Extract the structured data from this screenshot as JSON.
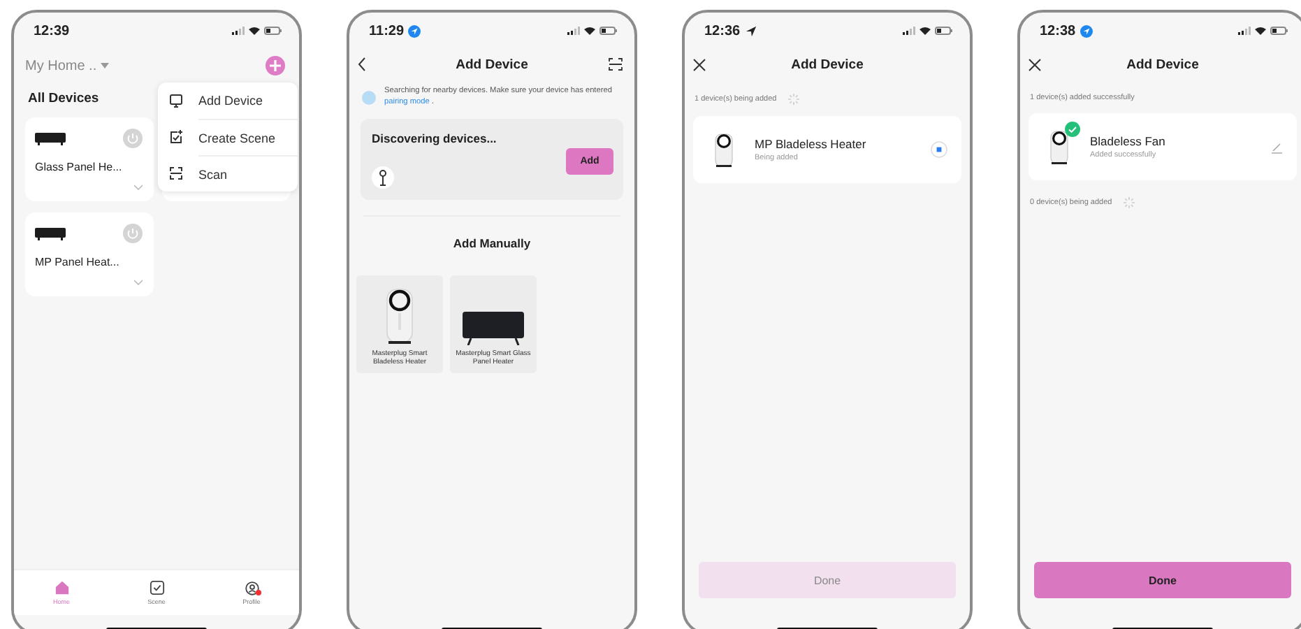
{
  "phones": [
    {
      "kind": "home",
      "time": "12:39",
      "home_name": "My Home ..",
      "section": "All Devices",
      "devices": [
        {
          "name": "Glass Panel He..."
        },
        {
          "name": "MP Panel Heat..."
        }
      ],
      "menu": [
        {
          "label": "Add Device",
          "kind": "device"
        },
        {
          "label": "Create Scene",
          "kind": "scene"
        },
        {
          "label": "Scan",
          "kind": "scan"
        }
      ],
      "tabs": [
        {
          "label": "Home",
          "kind": "home",
          "selected": true
        },
        {
          "label": "Scene",
          "kind": "scene",
          "selected": false
        },
        {
          "label": "Profile",
          "kind": "profile",
          "selected": false,
          "badge": true
        }
      ]
    },
    {
      "kind": "discover",
      "time": "11:29",
      "location": {
        "kind": "dot"
      },
      "title": "Add Device",
      "notice": "Searching for nearby devices. Make sure your device has entered ",
      "notice_link": "pairing mode",
      "notice_end": " .",
      "discovering": "Discovering devices...",
      "add_button": "Add",
      "manual_title": "Add Manually",
      "products": [
        {
          "name": "Masterplug Smart Bladeless Heater",
          "kind": "fan"
        },
        {
          "name": "Masterplug Smart Glass Panel Heater",
          "kind": "panel"
        }
      ]
    },
    {
      "kind": "result",
      "time": "12:36",
      "location": {
        "kind": "arrow"
      },
      "title": "Add Device",
      "groups": [
        {
          "label": "1 device(s) being added",
          "spinner": true,
          "devices": [
            {
              "name": "MP Bladeless Heater",
              "status": "Being added",
              "done": false
            }
          ]
        }
      ],
      "done_button": {
        "label": "Done",
        "disabled": true
      }
    },
    {
      "kind": "result",
      "time": "12:38",
      "location": {
        "kind": "dot"
      },
      "title": "Add Device",
      "groups": [
        {
          "label": "1 device(s) added successfully",
          "spinner": false,
          "devices": [
            {
              "name": "Bladeless Fan",
              "status": "Added successfully",
              "done": true
            }
          ]
        },
        {
          "label": "0 device(s) being added",
          "spinner": true
        }
      ],
      "done_button": {
        "label": "Done",
        "disabled": false
      }
    }
  ]
}
